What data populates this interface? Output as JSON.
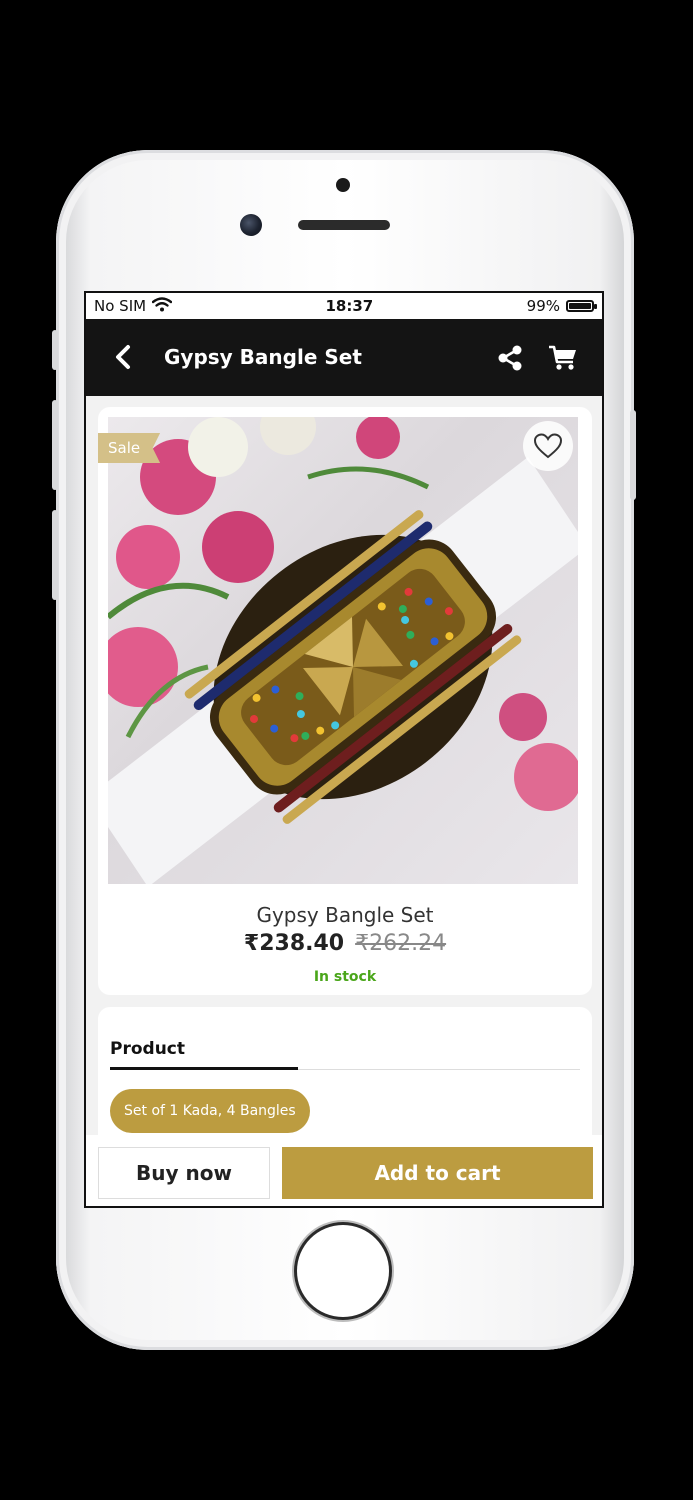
{
  "statusbar": {
    "carrier": "No SIM",
    "time": "18:37",
    "battery": "99%"
  },
  "appbar": {
    "title": "Gypsy Bangle Set"
  },
  "product": {
    "sale_badge": "Sale",
    "name": "Gypsy Bangle Set",
    "price": "₹238.40",
    "original_price": "₹262.24",
    "stock": "In stock"
  },
  "options": {
    "tab_label": "Product",
    "variant": "Set of 1 Kada, 4 Bangles"
  },
  "actions": {
    "buy_now": "Buy now",
    "add_to_cart": "Add to cart"
  },
  "colors": {
    "accent": "#BC9C40",
    "stock_green": "#4AA61A",
    "header_bg": "#141414",
    "sale_badge": "#D4C088"
  },
  "icons": [
    "back-icon",
    "share-icon",
    "cart-icon",
    "heart-icon",
    "wifi-icon",
    "battery-icon"
  ]
}
